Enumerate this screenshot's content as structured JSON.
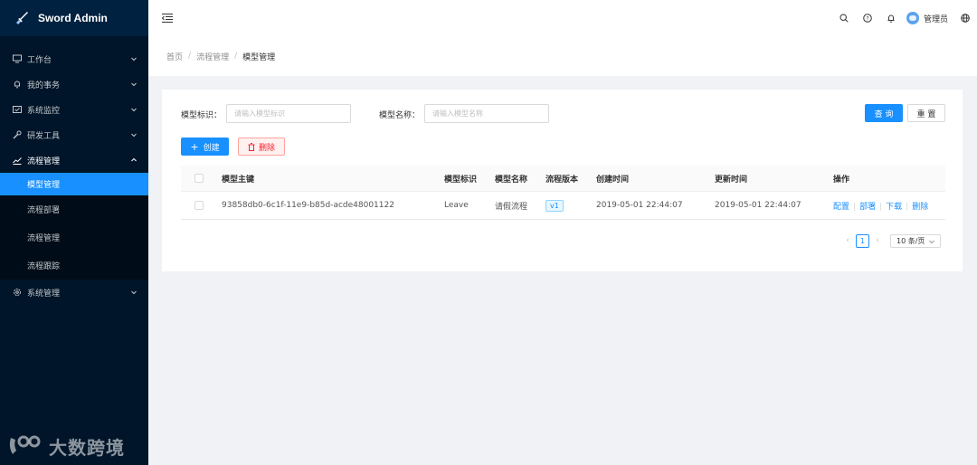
{
  "app": {
    "title": "Sword Admin"
  },
  "sidebar": {
    "items": [
      {
        "label": "工作台",
        "icon": "monitor-icon"
      },
      {
        "label": "我的事务",
        "icon": "bell-icon"
      },
      {
        "label": "系统监控",
        "icon": "mail-icon"
      },
      {
        "label": "研发工具",
        "icon": "tool-icon"
      },
      {
        "label": "流程管理",
        "icon": "chart-icon"
      },
      {
        "label": "系统管理",
        "icon": "setting-icon"
      }
    ],
    "sub_items": [
      "模型管理",
      "流程部署",
      "流程管理",
      "流程跟踪"
    ],
    "active_sub": "模型管理"
  },
  "header": {
    "user_name": "管理员"
  },
  "breadcrumb": [
    "首页",
    "流程管理",
    "模型管理"
  ],
  "search": {
    "key_label": "模型标识：",
    "key_placeholder": "请输入模型标识",
    "name_label": "模型名称：",
    "name_placeholder": "请输入模型名称",
    "query_btn": "查 询",
    "reset_btn": "重 置"
  },
  "actions": {
    "create": "创建",
    "delete": "删除"
  },
  "table": {
    "columns": [
      "模型主键",
      "模型标识",
      "模型名称",
      "流程版本",
      "创建时间",
      "更新时间",
      "操作"
    ],
    "rows": [
      {
        "id": "93858db0-6c1f-11e9-b85d-acde48001122",
        "key": "Leave",
        "name": "请假流程",
        "version": "v1",
        "created": "2019-05-01 22:44:07",
        "updated": "2019-05-01 22:44:07",
        "ops": [
          "配置",
          "部署",
          "下载",
          "删除"
        ]
      }
    ]
  },
  "pagination": {
    "current": "1",
    "page_size": "10 条/页"
  },
  "watermark": {
    "text": "大数跨境"
  },
  "colors": {
    "primary": "#1890ff",
    "sidebar_bg": "#001529",
    "danger": "#f5222d"
  }
}
